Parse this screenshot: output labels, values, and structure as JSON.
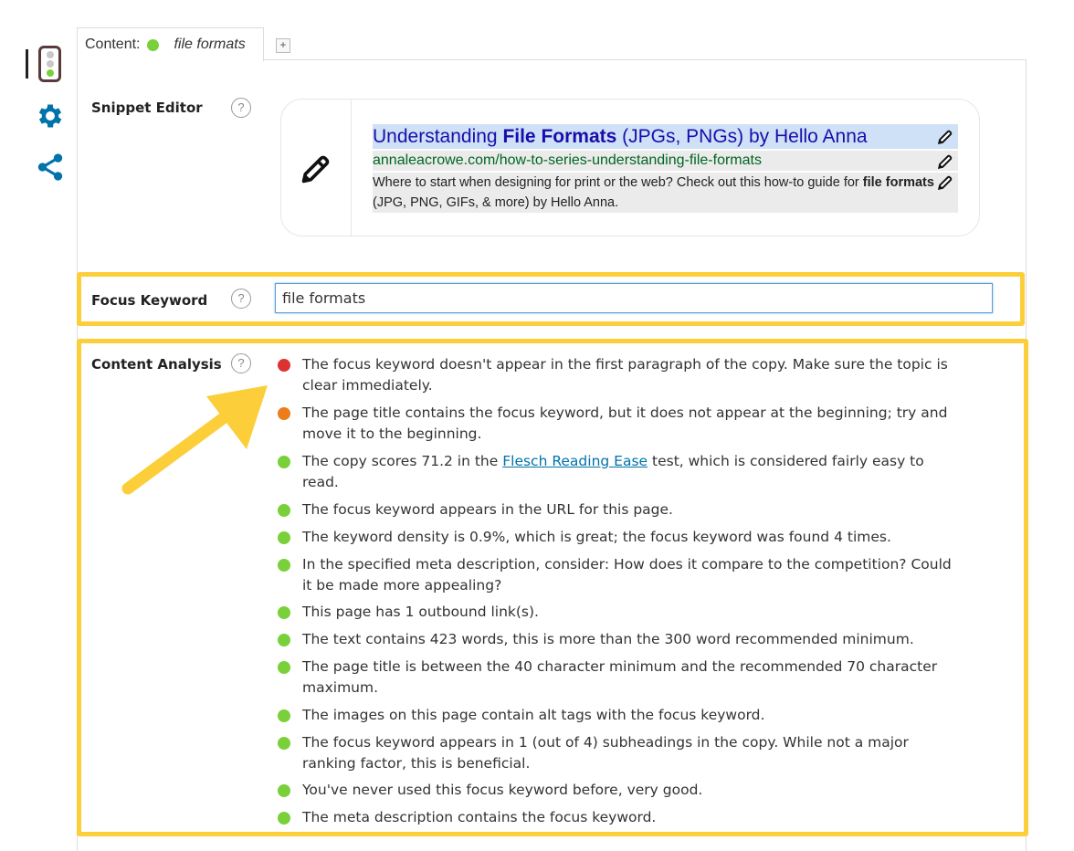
{
  "colors": {
    "good": "#7ad03a",
    "ok": "#ee7c1b",
    "bad": "#dc3232",
    "accent_blue": "#0073aa",
    "highlight": "#fcce3a"
  },
  "sidebar": {
    "icons": [
      "traffic-light-icon",
      "gear-icon",
      "share-icon"
    ]
  },
  "tabs": {
    "prefix": "Content:",
    "keyword": "file formats",
    "add_label": "+"
  },
  "snippet": {
    "label": "Snippet Editor",
    "help": "?",
    "title_before": "Understanding ",
    "title_bold": "File Formats",
    "title_after": " (JPGs, PNGs) by Hello Anna",
    "url": "annaleacrowe.com/how-to-series-understanding-file-formats",
    "desc_before": "Where to start when designing for print or the web? Check out this how-to guide for ",
    "desc_bold": "file formats",
    "desc_after": " (JPG, PNG, GIFs, & more) by Hello Anna."
  },
  "focus": {
    "label": "Focus Keyword",
    "help": "?",
    "value": "file formats"
  },
  "analysis": {
    "label": "Content Analysis",
    "help": "?",
    "results": [
      {
        "status": "bad",
        "text": "The focus keyword doesn't appear in the first paragraph of the copy. Make sure the topic is clear immediately."
      },
      {
        "status": "ok",
        "text": "The page title contains the focus keyword, but it does not appear at the beginning; try and move it to the beginning."
      },
      {
        "status": "good",
        "text_before": "The copy scores 71.2 in the ",
        "link": "Flesch Reading Ease",
        "text_after": " test, which is considered fairly easy to read."
      },
      {
        "status": "good",
        "text": "The focus keyword appears in the URL for this page."
      },
      {
        "status": "good",
        "text": "The keyword density is 0.9%, which is great; the focus keyword was found 4 times."
      },
      {
        "status": "good",
        "text": "In the specified meta description, consider: How does it compare to the competition? Could it be made more appealing?"
      },
      {
        "status": "good",
        "text": "This page has 1 outbound link(s)."
      },
      {
        "status": "good",
        "text": "The text contains 423 words, this is more than the 300 word recommended minimum."
      },
      {
        "status": "good",
        "text": "The page title is between the 40 character minimum and the recommended 70 character maximum."
      },
      {
        "status": "good",
        "text": "The images on this page contain alt tags with the focus keyword."
      },
      {
        "status": "good",
        "text": "The focus keyword appears in 1 (out of 4) subheadings in the copy. While not a major ranking factor, this is beneficial."
      },
      {
        "status": "good",
        "text": "You've never used this focus keyword before, very good."
      },
      {
        "status": "good",
        "text": "The meta description contains the focus keyword."
      }
    ]
  }
}
